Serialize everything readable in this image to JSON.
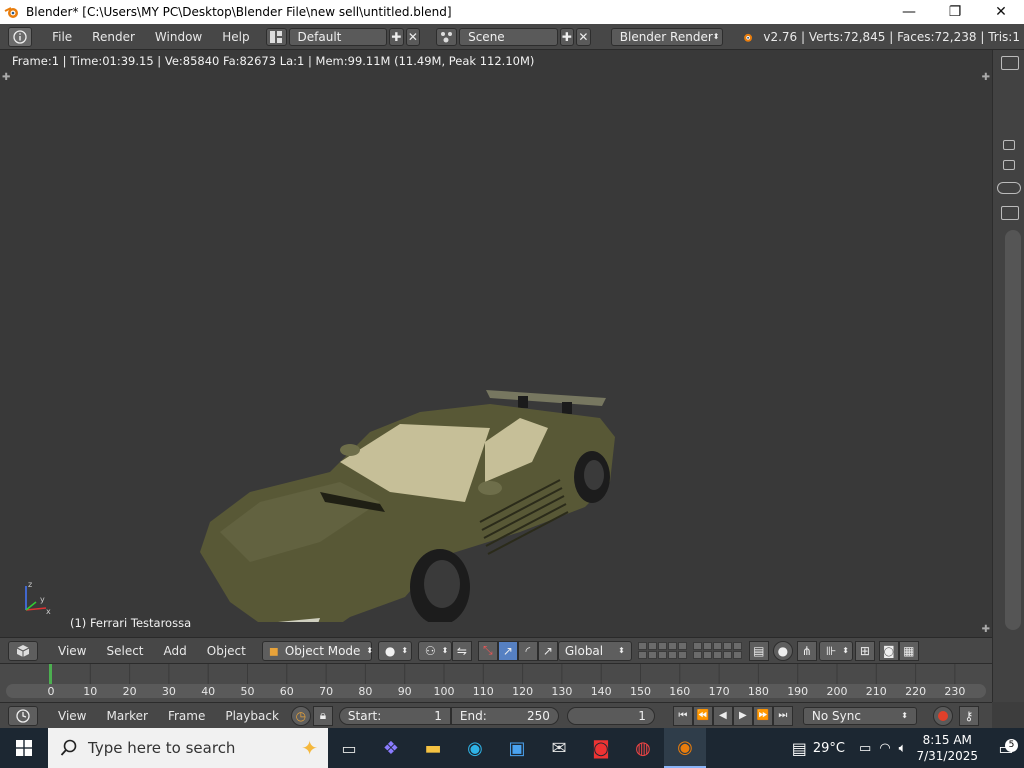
{
  "window": {
    "title": "Blender* [C:\\Users\\MY PC\\Desktop\\Blender File\\new sell\\untitled.blend]",
    "minimize": "—",
    "maximize": "❐",
    "close": "✕"
  },
  "info_header": {
    "menus": [
      "File",
      "Render",
      "Window",
      "Help"
    ],
    "layout": "Default",
    "scene": "Scene",
    "engine": "Blender Render",
    "stats": "v2.76 | Verts:72,845 | Faces:72,238 | Tris:1"
  },
  "viewport": {
    "info": "Frame:1 | Time:01:39.15 | Ve:85840 Fa:82673 La:1 | Mem:99.11M (11.49M, Peak 112.10M)",
    "object_label": "(1) Ferrari Testarossa",
    "axis_x": "x",
    "axis_y": "y",
    "axis_z": "z",
    "car_color": "#5a5a38"
  },
  "view_header": {
    "menus": [
      "View",
      "Select",
      "Add",
      "Object"
    ],
    "mode": "Object Mode",
    "orientation": "Global"
  },
  "timeline": {
    "ticks": [
      "0",
      "10",
      "20",
      "30",
      "40",
      "50",
      "60",
      "70",
      "80",
      "90",
      "100",
      "110",
      "120",
      "130",
      "140",
      "150",
      "160",
      "170",
      "180",
      "190",
      "200",
      "210",
      "220",
      "230"
    ],
    "current_frame_marker_color": "#4caf50"
  },
  "timeline_header": {
    "menus": [
      "View",
      "Marker",
      "Frame",
      "Playback"
    ],
    "start_label": "Start:",
    "start_value": "1",
    "end_label": "End:",
    "end_value": "250",
    "current_frame": "1",
    "sync": "No Sync"
  },
  "taskbar": {
    "search_placeholder": "Type here to search",
    "temperature": "29°C",
    "time": "8:15 AM",
    "date": "7/31/2025",
    "notification_count": "5"
  }
}
